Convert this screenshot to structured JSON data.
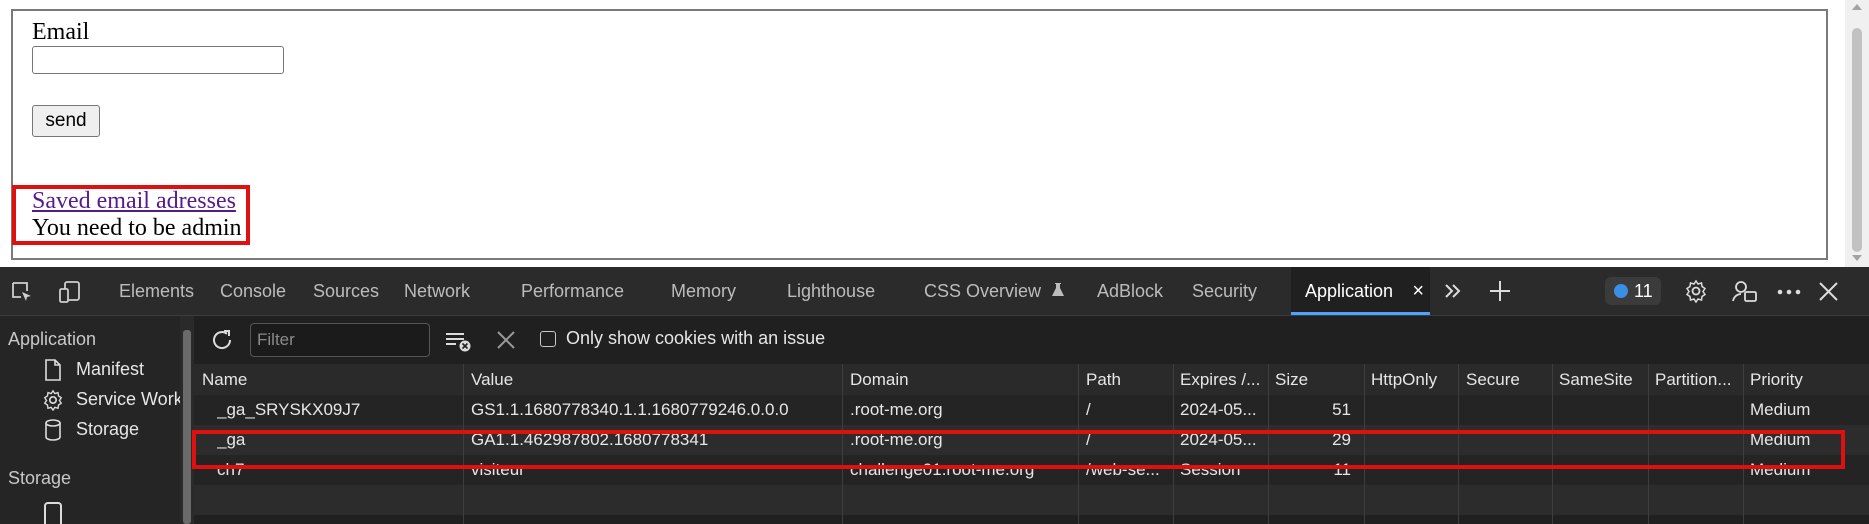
{
  "page": {
    "email_label": "Email",
    "email_value": "",
    "send_label": "send",
    "saved_link": "Saved email adresses",
    "admin_message": "You need to be admin"
  },
  "devtools": {
    "tabs": [
      "Elements",
      "Console",
      "Sources",
      "Network",
      "Performance",
      "Memory",
      "Lighthouse",
      "CSS Overview",
      "AdBlock",
      "Security",
      "Application"
    ],
    "active_tab": "Application",
    "issues_count": "11",
    "icons": [
      "inspect-icon",
      "device-toolbar-icon",
      "flask-icon",
      "close-icon",
      "more-tabs-icon",
      "add-icon",
      "settings-icon",
      "customize-icon",
      "more-icon",
      "close-devtools-icon"
    ]
  },
  "sidebar": {
    "application_heading": "Application",
    "items": [
      {
        "label": "Manifest",
        "icon": "file-icon"
      },
      {
        "label": "Service Work",
        "icon": "gear-icon"
      },
      {
        "label": "Storage",
        "icon": "database-icon"
      }
    ],
    "storage_heading": "Storage"
  },
  "toolbar": {
    "filter_placeholder": "Filter",
    "filter_value": "",
    "only_issue_label": "Only show cookies with an issue",
    "only_issue_checked": false
  },
  "cookies": {
    "columns": [
      "Name",
      "Value",
      "Domain",
      "Path",
      "Expires /...",
      "Size",
      "HttpOnly",
      "Secure",
      "SameSite",
      "Partition...",
      "Priority"
    ],
    "rows": [
      [
        "_ga_SRYSKX09J7",
        "GS1.1.1680778340.1.1.1680779246.0.0.0",
        ".root-me.org",
        "/",
        "2024-05...",
        "51",
        "",
        "",
        "",
        "",
        "Medium"
      ],
      [
        "_ga",
        "GA1.1.462987802.1680778341",
        ".root-me.org",
        "/",
        "2024-05...",
        "29",
        "",
        "",
        "",
        "",
        "Medium"
      ],
      [
        "ch7",
        "visiteur",
        "challenge01.root-me.org",
        "/web-se...",
        "Session",
        "11",
        "",
        "",
        "",
        "",
        "Medium"
      ]
    ]
  },
  "colors": {
    "highlight": "#e01010",
    "link": "#551a8b",
    "active_tab_underline": "#4da3ff"
  }
}
